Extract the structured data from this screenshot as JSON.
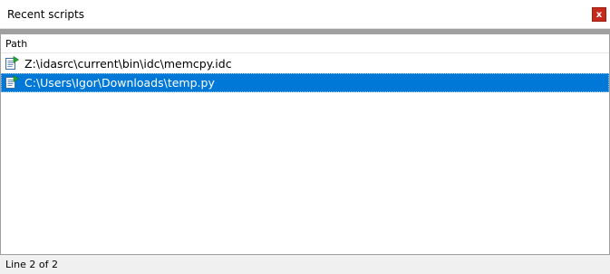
{
  "window": {
    "title": "Recent scripts",
    "close_label": "x"
  },
  "list": {
    "column_header": "Path",
    "rows": [
      {
        "path": "Z:\\idasrc\\current\\bin\\idc\\memcpy.idc",
        "icon": "script-file-icon",
        "selected": false
      },
      {
        "path": "C:\\Users\\Igor\\Downloads\\temp.py",
        "icon": "script-file-icon",
        "selected": true
      }
    ]
  },
  "status": {
    "text": "Line 2 of 2"
  },
  "colors": {
    "selection": "#0078d7",
    "close_button": "#c42b1c",
    "divider": "#a0a0a0",
    "status_bg": "#f0f0f0"
  }
}
